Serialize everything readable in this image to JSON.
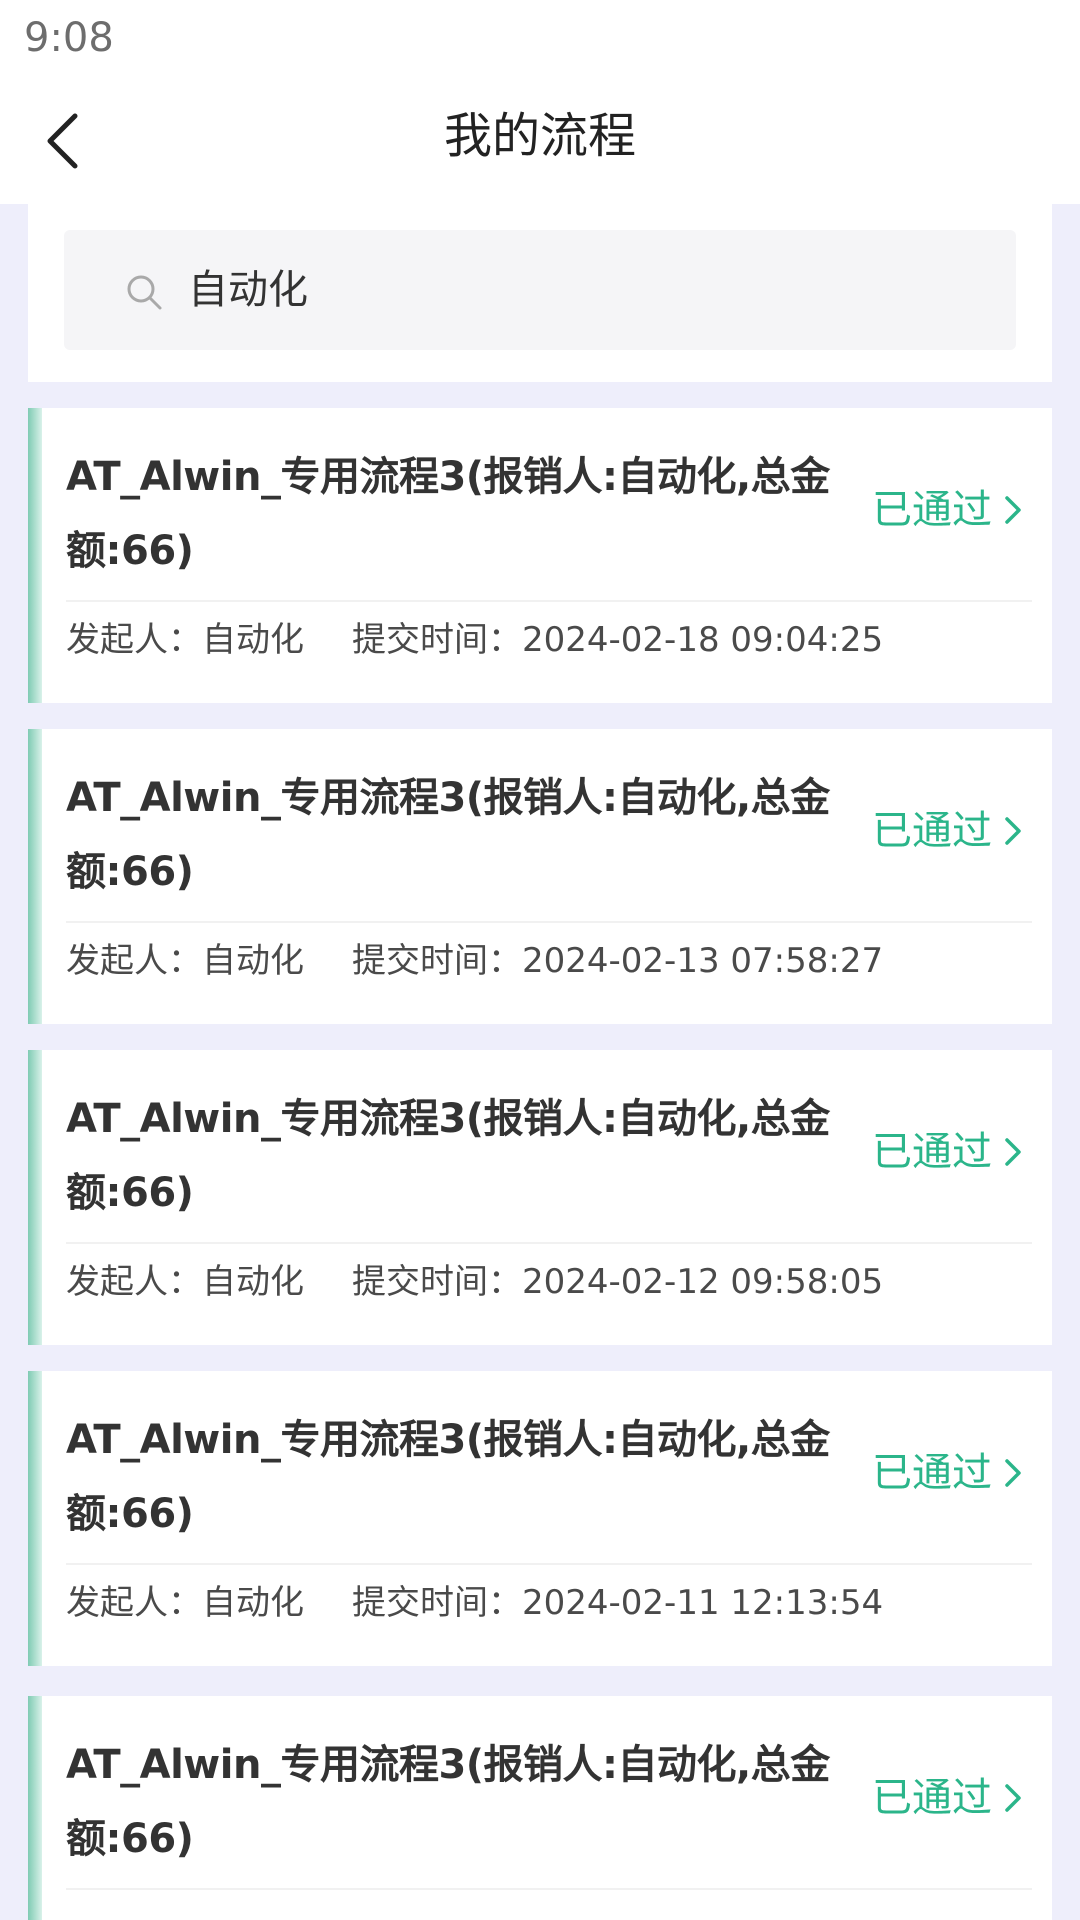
{
  "status_bar": {
    "time": "9:08"
  },
  "header": {
    "title": "我的流程"
  },
  "search": {
    "value": "自动化"
  },
  "colors": {
    "status_approved": "#2bb58a",
    "accent": "#7fcbb3",
    "background": "#eeeefb"
  },
  "icons": {
    "back": "chevron-left-icon",
    "search": "search-icon",
    "status_arrow": "chevron-right-icon"
  },
  "list": {
    "items": [
      {
        "title": "AT_Alwin_专用流程3(报销人:自动化,总金额:66)",
        "status": "已通过",
        "initiator_label": "发起人：",
        "initiator": "自动化",
        "time_label": "提交时间：",
        "time": "2024-02-18 09:04:25"
      },
      {
        "title": "AT_Alwin_专用流程3(报销人:自动化,总金额:66)",
        "status": "已通过",
        "initiator_label": "发起人：",
        "initiator": "自动化",
        "time_label": "提交时间：",
        "time": "2024-02-13 07:58:27"
      },
      {
        "title": "AT_Alwin_专用流程3(报销人:自动化,总金额:66)",
        "status": "已通过",
        "initiator_label": "发起人：",
        "initiator": "自动化",
        "time_label": "提交时间：",
        "time": "2024-02-12 09:58:05"
      },
      {
        "title": "AT_Alwin_专用流程3(报销人:自动化,总金额:66)",
        "status": "已通过",
        "initiator_label": "发起人：",
        "initiator": "自动化",
        "time_label": "提交时间：",
        "time": "2024-02-11 12:13:54"
      },
      {
        "title": "AT_Alwin_专用流程3(报销人:自动化,总金额:66)",
        "status": "已通过"
      }
    ]
  }
}
